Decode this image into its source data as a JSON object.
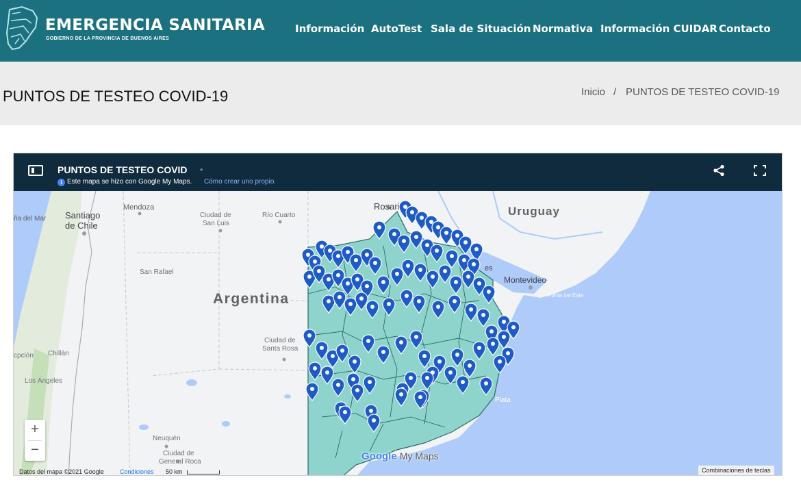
{
  "header": {
    "brand_title": "EMERGENCIA SANITARIA",
    "brand_subtitle": "GOBIERNO DE LA PROVINCIA DE BUENOS AIRES",
    "nav": [
      "Información",
      "AutoTest",
      "Sala de Situación",
      "Normativa",
      "Información CUIDAR",
      "Contacto"
    ],
    "bg_color": "#1b7180"
  },
  "page": {
    "title": "PUNTOS DE TESTEO COVID-19",
    "breadcrumb": [
      "Inicio",
      "/",
      "PUNTOS DE TESTEO COVID-19"
    ]
  },
  "map": {
    "title": "PUNTOS DE TESTEO COVID",
    "title_dot": "•",
    "info_icon": "i",
    "info_text": "Este mapa se hizo con Google My Maps.",
    "info_link": "Cómo crear uno propio.",
    "icons": [
      "panel-toggle-icon",
      "share-icon",
      "fullscreen-icon",
      "map-pin-icon"
    ],
    "labels": {
      "uruguay": "Uruguay",
      "argentina": "Argentina",
      "montevideo": "Montevideo",
      "mendoza": "Mendoza",
      "rosario": "Rosario",
      "santiago": "Santiago",
      "de_chile": "de Chile",
      "maipo": "ña del Mar",
      "san_luis_1": "Ciudad de",
      "san_luis_2": "San Luis",
      "rio_cuarto": "Río Cuarto",
      "san_rafael": "San Rafael",
      "santa_rosa_1": "Ciudad de",
      "santa_rosa_2": "Santa Rosa",
      "chillan": "Chillán",
      "concepcion": "cpción",
      "los_angeles": "Los Ángeles",
      "neuquen": "Neuquén",
      "gral_roca_1": "Ciudad de",
      "gral_roca_2": "General Roca",
      "punta_del_este": "Punta del Este",
      "mar_del_plata": "Plata",
      "ba_partial": "es"
    },
    "zoom_in": "+",
    "zoom_out": "−",
    "attribution": "Datos del mapa ©2021 Google",
    "conditions": "Condiciones",
    "scale": "50 km",
    "keyboard": "Combinaciones de teclas",
    "logo_google": "Google",
    "logo_mymaps": "My Maps",
    "pin_color": "#1e5bc6",
    "province_fill": "#8fd3cd",
    "water_color": "#aecbfa"
  }
}
